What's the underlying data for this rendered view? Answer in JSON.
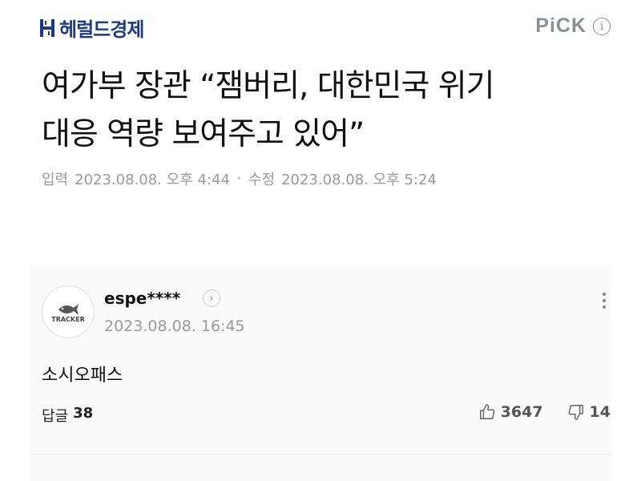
{
  "header": {
    "brand_name": "헤럴드경제",
    "pick_label": "PiCK",
    "info_icon_char": "i"
  },
  "article": {
    "headline_line1": "여가부 장관 “잼버리, 대한민국 위기",
    "headline_line2": "대응 역량 보여주고 있어”",
    "published_label": "입력",
    "published_date": "2023.08.08. 오후 4:44",
    "edited_label": "수정",
    "edited_date": "2023.08.08. 오후 5:24"
  },
  "comment": {
    "avatar_text": "TRACKER",
    "username": "espe****",
    "timestamp": "2023.08.08. 16:45",
    "text": "소시오패스",
    "reply_label": "답글",
    "reply_count": "38",
    "likes": "3647",
    "dislikes": "14"
  },
  "colors": {
    "brand": "#1b3a8a",
    "muted": "#9a9a9a"
  }
}
